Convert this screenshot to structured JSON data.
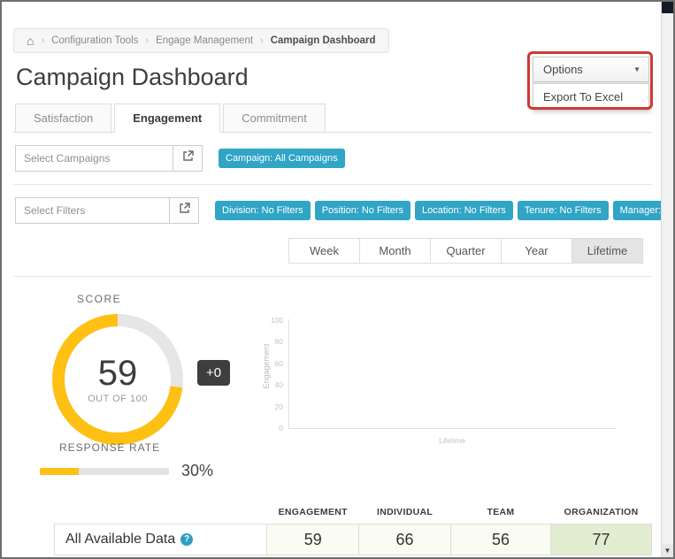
{
  "icons": {
    "home": "⌂",
    "caret_down": "▼",
    "help": "?",
    "scroll_down": "▼"
  },
  "breadcrumb": {
    "items": [
      "Configuration Tools",
      "Engage Management",
      "Campaign Dashboard"
    ]
  },
  "page": {
    "title": "Campaign Dashboard"
  },
  "options_menu": {
    "button_label": "Options",
    "items": [
      "Export To Excel"
    ]
  },
  "tabs": {
    "items": [
      "Satisfaction",
      "Engagement",
      "Commitment"
    ],
    "active": "Engagement"
  },
  "campaigns": {
    "placeholder": "Select Campaigns",
    "badge": "Campaign: All Campaigns"
  },
  "filters": {
    "placeholder": "Select Filters",
    "badges": [
      "Division: No Filters",
      "Position: No Filters",
      "Location: No Filters",
      "Tenure: No Filters",
      "Manager: No Filters"
    ]
  },
  "periods": {
    "items": [
      "Week",
      "Month",
      "Quarter",
      "Year",
      "Lifetime"
    ],
    "selected": "Lifetime"
  },
  "score": {
    "label": "SCORE",
    "value": "59",
    "caption": "OUT OF 100",
    "delta": "+0",
    "max": 100
  },
  "response_rate": {
    "label": "RESPONSE RATE",
    "display": "30%",
    "percent": 30
  },
  "chart_data": {
    "type": "line",
    "title": "",
    "xlabel": "",
    "ylabel": "Engagement",
    "x_categories": [
      "Lifetime"
    ],
    "y_ticks": [
      "100",
      "80",
      "60",
      "40",
      "20",
      "0"
    ],
    "ylim": [
      0,
      100
    ],
    "series": [],
    "grid": false,
    "legend": "none"
  },
  "summary_table": {
    "columns": [
      "ENGAGEMENT",
      "INDIVIDUAL",
      "TEAM",
      "ORGANIZATION"
    ],
    "row_label": "All Available Data",
    "values": [
      "59",
      "66",
      "56",
      "77"
    ],
    "highlight_column": "ORGANIZATION"
  },
  "colors": {
    "accent_blue": "#30a5c6",
    "gauge_yellow": "#fdc013",
    "delta_badge_bg": "#3e3e3e",
    "highlight_green": "#e2edd2",
    "annotation_red": "#cd3a35",
    "selected_period_bg": "#e4e4e4"
  }
}
